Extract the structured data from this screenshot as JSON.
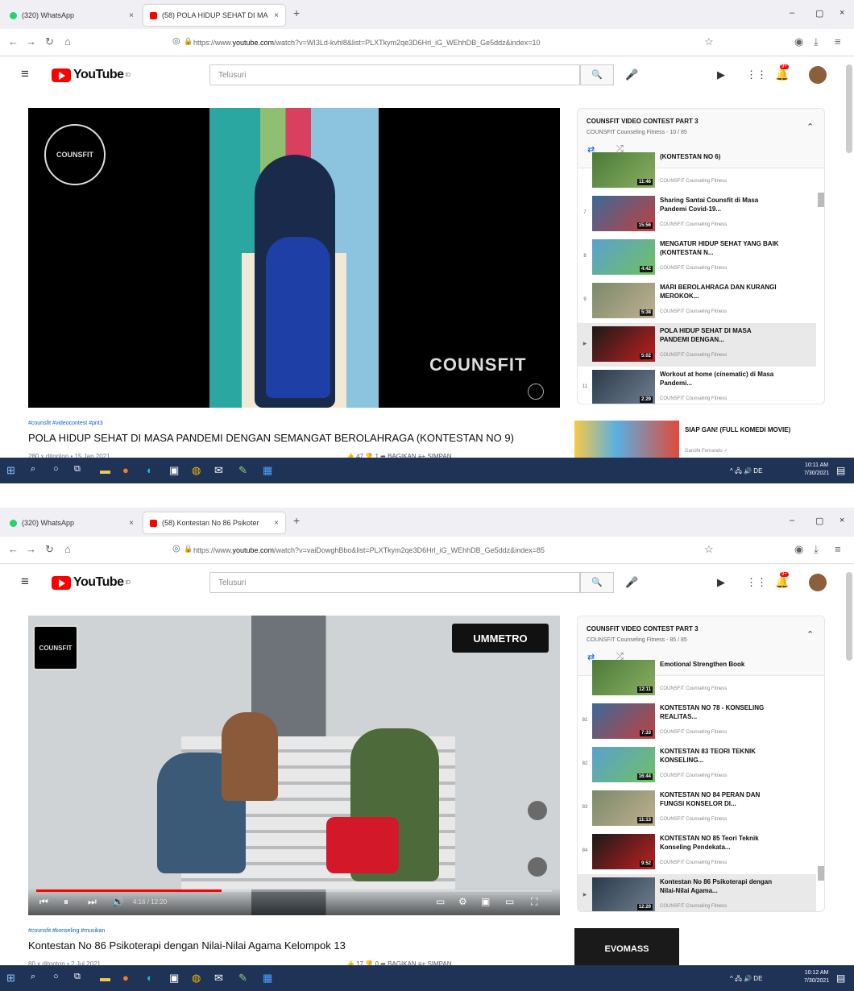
{
  "screens": [
    {
      "tabs": {
        "whatsapp": {
          "label": "(320) WhatsApp",
          "close": "×"
        },
        "youtube": {
          "label": "(58) POLA HIDUP SEHAT DI MA",
          "close": "×"
        },
        "new_tab": "+"
      },
      "window_controls": {
        "minimize": "–",
        "maximize": "▢",
        "close": "×"
      },
      "nav": {
        "back": "←",
        "forward": "→",
        "reload": "↻",
        "home": "⌂",
        "shield": "◎",
        "lock": "🔒"
      },
      "url": {
        "prefix": "https://www.",
        "domain": "youtube.com",
        "path": "/watch?v=WI3Ld-kvhl8&list=PLXTkym2qe3D6Hrl_iG_WEhhDB_Ge5ddz&index=10"
      },
      "yt": {
        "logo_text": "YouTube",
        "logo_sup": "ID",
        "search_placeholder": "Telusuri",
        "bell_badge": "9+"
      },
      "video": {
        "watermark_small": "COUNSFIT",
        "watermark_big": "COUNSFIT",
        "hashtags": "#counsfit #videocontest #pnt3",
        "title": "POLA HIDUP SEHAT DI MASA PANDEMI DENGAN SEMANGAT BEROLAHRAGA (KONTESTAN NO 9)",
        "meta": "280 x ditonton • 15 Jan 2021",
        "actions": "👍 47   👎 1   ➦ BAGIKAN   ≡+ SIMPAN"
      },
      "playlist": {
        "title": "COUNSFIT VIDEO CONTEST PART 3",
        "sub": "COUNSFIT Counseling Fitness - 10 / 85",
        "items": [
          {
            "idx": "",
            "title": "(KONTESTAN NO 6)",
            "channel": "COUNSFIT Counseling Fitness",
            "dur": "11:46"
          },
          {
            "idx": "7",
            "title": "Sharing Santai Counsfit di Masa Pandemi Covid-19...",
            "channel": "COUNSFIT Counseling Fitness",
            "dur": "15:56"
          },
          {
            "idx": "8",
            "title": "MENGATUR HIDUP SEHAT YANG BAIK (KONTESTAN N...",
            "channel": "COUNSFIT Counseling Fitness",
            "dur": "4:42"
          },
          {
            "idx": "9",
            "title": "MARI BEROLAHRAGA DAN KURANGI MEROKOK...",
            "channel": "COUNSFIT Counseling Fitness",
            "dur": "5:38"
          },
          {
            "idx": "▶",
            "title": "POLA HIDUP SEHAT DI MASA PANDEMI DENGAN...",
            "channel": "COUNSFIT Counseling Fitness",
            "dur": "5:02"
          },
          {
            "idx": "11",
            "title": "Workout at home (cinematic) di Masa Pandemi...",
            "channel": "COUNSFIT Counseling Fitness",
            "dur": "2:29"
          }
        ]
      },
      "rec": {
        "title": "SIAP GAN! (FULL KOMEDI MOVIE)",
        "channel": "Gandhi Fernando ✓"
      },
      "taskbar": {
        "tray": "^ 🖧 🔊 DE",
        "time": "10:11 AM",
        "date": "7/30/2021"
      }
    },
    {
      "tabs": {
        "whatsapp": {
          "label": "(320) WhatsApp",
          "close": "×"
        },
        "youtube": {
          "label": "(58) Kontestan No 86 Psikoter",
          "close": "×"
        },
        "new_tab": "+"
      },
      "window_controls": {
        "minimize": "–",
        "maximize": "▢",
        "close": "×"
      },
      "nav": {
        "back": "←",
        "forward": "→",
        "reload": "↻",
        "home": "⌂",
        "shield": "◎",
        "lock": "🔒"
      },
      "url": {
        "prefix": "https://www.",
        "domain": "youtube.com",
        "path": "/watch?v=vaiDowghBbo&list=PLXTkym2qe3D6Hrl_iG_WEhhDB_Ge5ddz&index=85"
      },
      "yt": {
        "logo_text": "YouTube",
        "logo_sup": "ID",
        "search_placeholder": "Telusuri",
        "bell_badge": "9+"
      },
      "video": {
        "watermark_small": "COUNSFIT",
        "um_logo": "UMMETRO",
        "hashtags": "#counsfit #konseling #musikan",
        "title": "Kontestan No 86 Psikoterapi dengan Nilai-Nilai Agama Kelompok 13",
        "meta": "80 x ditonton • 2 Jul 2021",
        "actions": "👍 17   👎 0   ➦ BAGIKAN   ≡+ SIMPAN",
        "time": "4:16 / 12:20",
        "progress": 0.36
      },
      "playlist": {
        "title": "COUNSFIT VIDEO CONTEST PART 3",
        "sub": "COUNSFIT Counseling Fitness - 85 / 85",
        "items": [
          {
            "idx": "",
            "title": "Emotional Strengthen Book",
            "channel": "COUNSFIT Counseling Fitness",
            "dur": "12:11"
          },
          {
            "idx": "81",
            "title": "KONTESTAN NO 78 - KONSELING REALITAS...",
            "channel": "COUNSFIT Counseling Fitness",
            "dur": "7:33"
          },
          {
            "idx": "82",
            "title": "KONTESTAN 83 TEORI TEKNIK KONSELING...",
            "channel": "COUNSFIT Counseling Fitness",
            "dur": "16:44"
          },
          {
            "idx": "83",
            "title": "KONTESTAN NO 84 PERAN DAN FUNGSI KONSELOR DI...",
            "channel": "COUNSFIT Counseling Fitness",
            "dur": "11:13"
          },
          {
            "idx": "84",
            "title": "KONTESTAN NO 85 Teori Teknik Konseling Pendekata...",
            "channel": "COUNSFIT Counseling Fitness",
            "dur": "9:52"
          },
          {
            "idx": "▶",
            "title": "Kontestan No 86 Psikoterapi dengan Nilai-Nilai Agama...",
            "channel": "COUNSFIT Counseling Fitness",
            "dur": "12:20"
          }
        ]
      },
      "rec": {
        "title": "",
        "channel": ""
      },
      "rec_thumb_text": "EVOMASS",
      "taskbar": {
        "tray": "^ 🖧 🔊 DE",
        "time": "10:12 AM",
        "date": "7/30/2021"
      }
    }
  ],
  "colors": {
    "yt_red": "#ff0000",
    "link_blue": "#065fd4",
    "taskbar": "#1f3357"
  }
}
